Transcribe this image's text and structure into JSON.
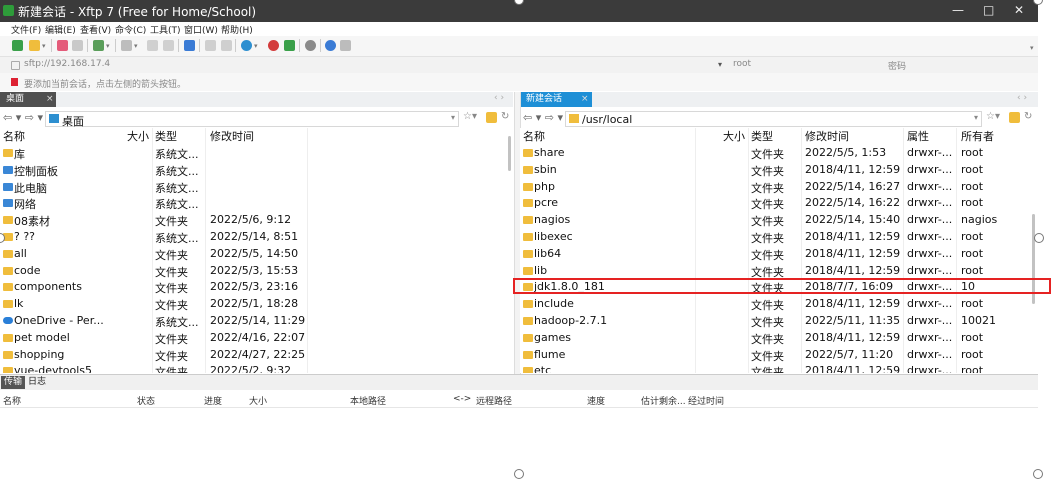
{
  "window": {
    "title": "新建会话 - Xftp 7 (Free for Home/School)",
    "minimize": "—",
    "maximize": "□",
    "close": "✕"
  },
  "menu": [
    "文件(F)",
    "编辑(E)",
    "查看(V)",
    "命令(C)",
    "工具(T)",
    "窗口(W)",
    "帮助(H)"
  ],
  "address": {
    "url": "sftp://192.168.17.4",
    "username": "root",
    "password_placeholder": "密码"
  },
  "hint": "要添加当前会话，点击左侧的箭头按钮。",
  "tabs": {
    "left": {
      "label": "桌面",
      "close": "×"
    },
    "right": {
      "label": "新建会话",
      "close": "×"
    }
  },
  "left": {
    "path": "桌面",
    "headers": {
      "name": "名称",
      "size": "大小",
      "type": "类型",
      "mtime": "修改时间"
    },
    "rows": [
      {
        "name": "库",
        "size": "",
        "type": "系统文...",
        "mtime": "",
        "icon": "folder-icon"
      },
      {
        "name": "控制面板",
        "size": "",
        "type": "系统文...",
        "mtime": "",
        "icon": "control-panel-icon"
      },
      {
        "name": "此电脑",
        "size": "",
        "type": "系统文...",
        "mtime": "",
        "icon": "computer-icon"
      },
      {
        "name": "网络",
        "size": "",
        "type": "系统文...",
        "mtime": "",
        "icon": "network-icon"
      },
      {
        "name": "08素材",
        "size": "",
        "type": "文件夹",
        "mtime": "2022/5/6, 9:12",
        "icon": "folder-icon"
      },
      {
        "name": "? ??",
        "size": "",
        "type": "系统文...",
        "mtime": "2022/5/14, 8:51",
        "icon": "folder-icon"
      },
      {
        "name": "all",
        "size": "",
        "type": "文件夹",
        "mtime": "2022/5/5, 14:50",
        "icon": "folder-icon"
      },
      {
        "name": "code",
        "size": "",
        "type": "文件夹",
        "mtime": "2022/5/3, 15:53",
        "icon": "folder-icon"
      },
      {
        "name": "components",
        "size": "",
        "type": "文件夹",
        "mtime": "2022/5/3, 23:16",
        "icon": "folder-icon"
      },
      {
        "name": "lk",
        "size": "",
        "type": "文件夹",
        "mtime": "2022/5/1, 18:28",
        "icon": "folder-icon"
      },
      {
        "name": "OneDrive - Per...",
        "size": "",
        "type": "系统文...",
        "mtime": "2022/5/14, 11:29",
        "icon": "onedrive-icon"
      },
      {
        "name": "pet model",
        "size": "",
        "type": "文件夹",
        "mtime": "2022/4/16, 22:07",
        "icon": "folder-icon"
      },
      {
        "name": "shopping",
        "size": "",
        "type": "文件夹",
        "mtime": "2022/4/27, 22:25",
        "icon": "folder-icon"
      },
      {
        "name": "vue-devtools5",
        "size": "",
        "type": "文件夹",
        "mtime": "2022/5/2, 9:32",
        "icon": "folder-icon"
      }
    ]
  },
  "right": {
    "path": "/usr/local",
    "headers": {
      "name": "名称",
      "size": "大小",
      "type": "类型",
      "mtime": "修改时间",
      "attr": "属性",
      "owner": "所有者"
    },
    "rows": [
      {
        "name": "share",
        "size": "",
        "type": "文件夹",
        "mtime": "2022/5/5, 1:53",
        "attr": "drwxr-...",
        "owner": "root"
      },
      {
        "name": "sbin",
        "size": "",
        "type": "文件夹",
        "mtime": "2018/4/11, 12:59",
        "attr": "drwxr-...",
        "owner": "root"
      },
      {
        "name": "php",
        "size": "",
        "type": "文件夹",
        "mtime": "2022/5/14, 16:27",
        "attr": "drwxr-...",
        "owner": "root"
      },
      {
        "name": "pcre",
        "size": "",
        "type": "文件夹",
        "mtime": "2022/5/14, 16:22",
        "attr": "drwxr-...",
        "owner": "root"
      },
      {
        "name": "nagios",
        "size": "",
        "type": "文件夹",
        "mtime": "2022/5/14, 15:40",
        "attr": "drwxr-...",
        "owner": "nagios"
      },
      {
        "name": "libexec",
        "size": "",
        "type": "文件夹",
        "mtime": "2018/4/11, 12:59",
        "attr": "drwxr-...",
        "owner": "root"
      },
      {
        "name": "lib64",
        "size": "",
        "type": "文件夹",
        "mtime": "2018/4/11, 12:59",
        "attr": "drwxr-...",
        "owner": "root"
      },
      {
        "name": "lib",
        "size": "",
        "type": "文件夹",
        "mtime": "2018/4/11, 12:59",
        "attr": "drwxr-...",
        "owner": "root"
      },
      {
        "name": "jdk1.8.0_181",
        "size": "",
        "type": "文件夹",
        "mtime": "2018/7/7, 16:09",
        "attr": "drwxr-...",
        "owner": "10"
      },
      {
        "name": "include",
        "size": "",
        "type": "文件夹",
        "mtime": "2018/4/11, 12:59",
        "attr": "drwxr-...",
        "owner": "root"
      },
      {
        "name": "hadoop-2.7.1",
        "size": "",
        "type": "文件夹",
        "mtime": "2022/5/11, 11:35",
        "attr": "drwxr-...",
        "owner": "10021"
      },
      {
        "name": "games",
        "size": "",
        "type": "文件夹",
        "mtime": "2018/4/11, 12:59",
        "attr": "drwxr-...",
        "owner": "root"
      },
      {
        "name": "flume",
        "size": "",
        "type": "文件夹",
        "mtime": "2022/5/7, 11:20",
        "attr": "drwxr-...",
        "owner": "root"
      },
      {
        "name": "etc",
        "size": "",
        "type": "文件夹",
        "mtime": "2018/4/11, 12:59",
        "attr": "drwxr-...",
        "owner": "root"
      }
    ]
  },
  "bottom": {
    "tabs": [
      "传输",
      "日志"
    ],
    "headers": [
      "名称",
      "状态",
      "进度",
      "大小",
      "本地路径",
      "<->",
      "远程路径",
      "速度",
      "估计剩余...",
      "经过时间"
    ]
  },
  "colors": {
    "accent": "#1e8fd6",
    "titlebar": "#3b3b3b",
    "highlight": "#e52222",
    "folder": "#f0bd3c"
  }
}
